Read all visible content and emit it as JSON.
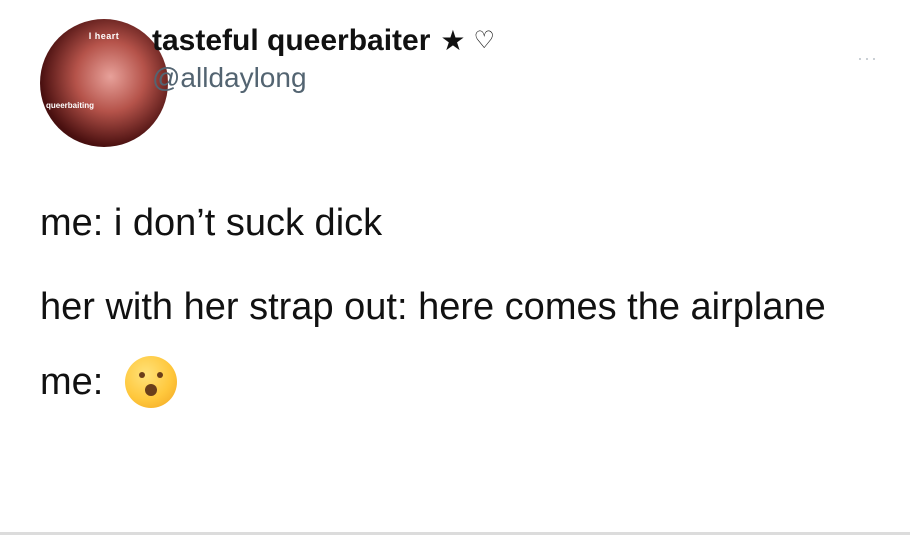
{
  "author": {
    "display_name": "tasteful queerbaiter",
    "star": "★",
    "heart": "♡",
    "handle": "@alldaylong",
    "avatar_text_top": "I heart",
    "avatar_text_side": "queerbaiting"
  },
  "more_menu": "···",
  "tweet": {
    "line1": "me: i don’t suck dick",
    "line2": "her with her strap out: here comes the airplane",
    "line3_prefix": "me:",
    "emoji": "hushed-face-emoji"
  }
}
